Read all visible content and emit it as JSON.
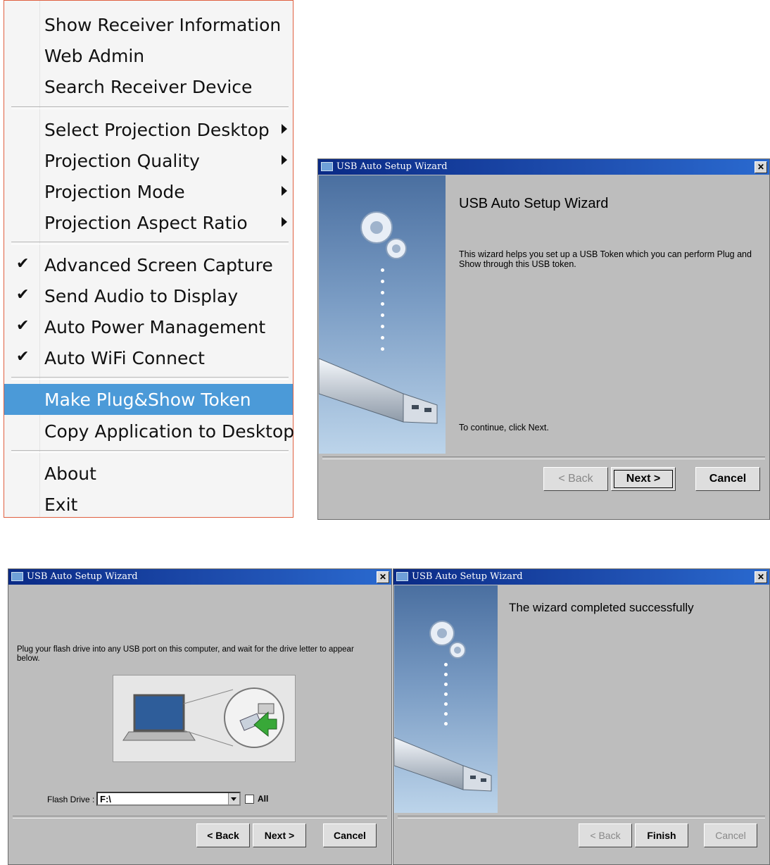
{
  "menu": {
    "group1": [
      "Show Receiver Information",
      "Web Admin",
      "Search Receiver Device"
    ],
    "group2": [
      "Select Projection Desktop",
      "Projection Quality",
      "Projection Mode",
      "Projection Aspect Ratio"
    ],
    "group3": [
      "Advanced Screen Capture",
      "Send Audio to Display",
      "Auto Power Management",
      "Auto WiFi Connect"
    ],
    "group4": [
      "Make Plug&Show Token",
      "Copy Application to Desktop"
    ],
    "group5": [
      "About",
      "Exit"
    ],
    "highlighted": "Make Plug&Show Token",
    "check_mark": "✔",
    "highlight_color": "#4b9ad8"
  },
  "wizard1": {
    "title": "USB Auto Setup Wizard",
    "heading": "USB Auto Setup Wizard",
    "description": "This wizard helps you set up a USB Token which you can perform Plug and Show through this USB token.",
    "continue_text": "To continue, click Next.",
    "back": "< Back",
    "next": "Next >",
    "cancel": "Cancel"
  },
  "wizard2": {
    "title": "USB Auto Setup Wizard",
    "instruction": "Plug your flash drive into any USB port on this computer, and wait for the drive letter to appear below.",
    "flash_drive_label": "Flash Drive :",
    "flash_drive_value": "F:\\",
    "all_label": "All",
    "back": "< Back",
    "next": "Next >",
    "cancel": "Cancel"
  },
  "wizard3": {
    "title": "USB Auto Setup Wizard",
    "heading": "The wizard completed successfully",
    "back": "< Back",
    "finish": "Finish",
    "cancel": "Cancel"
  },
  "icons": [
    "gear-icon",
    "usb-drive-icon",
    "laptop-icon",
    "usb-plug-icon",
    "close-icon",
    "window-icon",
    "submenu-arrow-icon",
    "dropdown-arrow-icon",
    "checkbox-icon"
  ]
}
